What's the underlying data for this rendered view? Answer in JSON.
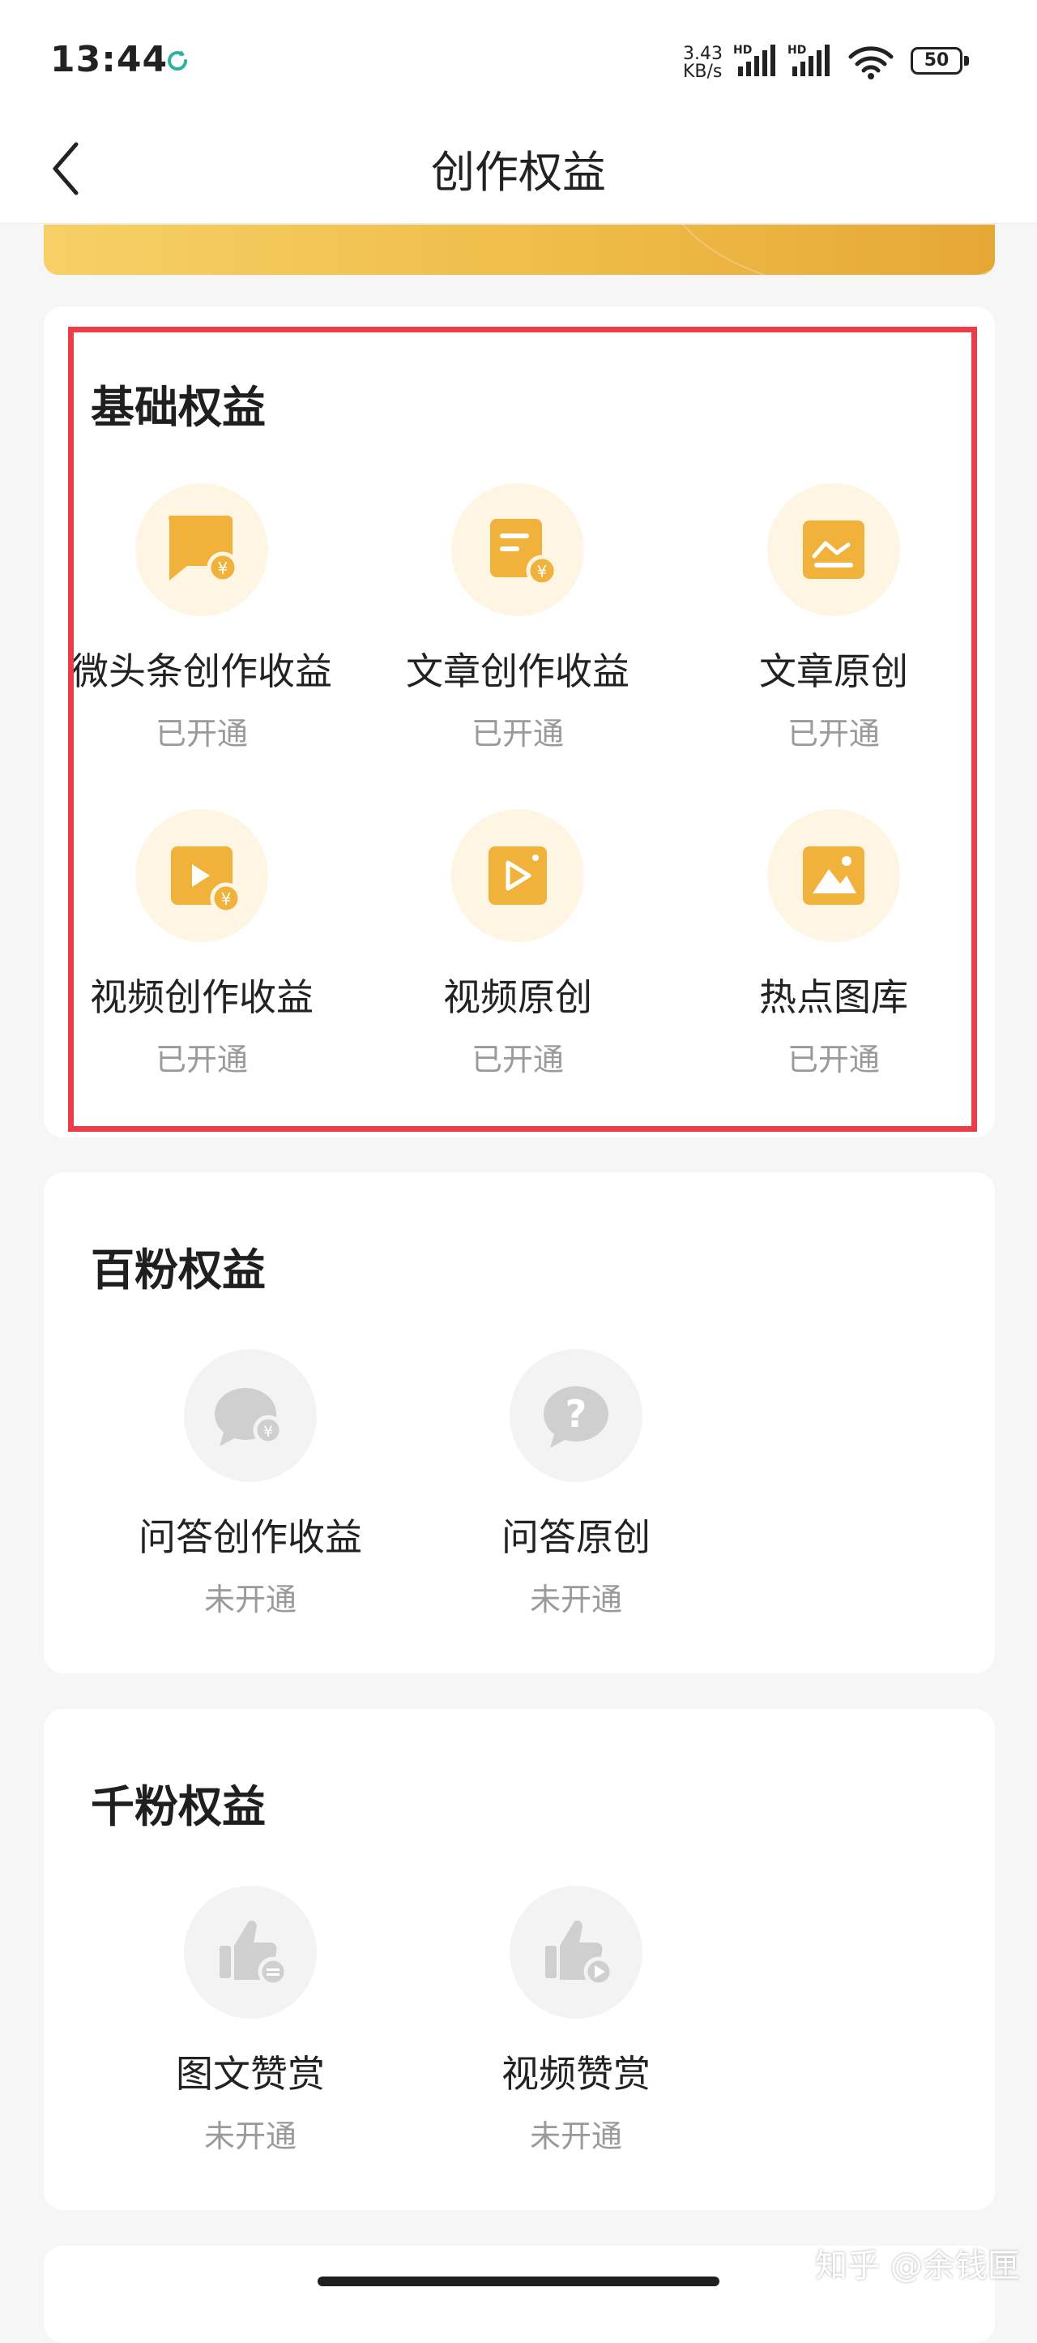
{
  "status_bar": {
    "time": "13:44",
    "speed_value": "3.43",
    "speed_unit": "KB/s",
    "network_1": "HD",
    "network_2": "HD",
    "battery": "50"
  },
  "nav": {
    "title": "创作权益"
  },
  "colors": {
    "accent_gold": "#efbc48",
    "highlight_red": "#ec3b49",
    "status_gray": "#9a9a9a"
  },
  "sections": [
    {
      "title": "基础权益",
      "items": [
        {
          "label": "微头条创作收益",
          "status": "已开通",
          "icon": "speech-bubble-coin-icon"
        },
        {
          "label": "文章创作收益",
          "status": "已开通",
          "icon": "document-coin-icon"
        },
        {
          "label": "文章原创",
          "status": "已开通",
          "icon": "article-chart-icon"
        },
        {
          "label": "视频创作收益",
          "status": "已开通",
          "icon": "video-coin-icon"
        },
        {
          "label": "视频原创",
          "status": "已开通",
          "icon": "video-play-icon"
        },
        {
          "label": "热点图库",
          "status": "已开通",
          "icon": "image-gallery-icon"
        }
      ]
    },
    {
      "title": "百粉权益",
      "items": [
        {
          "label": "问答创作收益",
          "status": "未开通",
          "icon": "qa-coin-icon"
        },
        {
          "label": "问答原创",
          "status": "未开通",
          "icon": "question-bubble-icon"
        }
      ]
    },
    {
      "title": "千粉权益",
      "items": [
        {
          "label": "图文赞赏",
          "status": "未开通",
          "icon": "thumbs-up-text-icon"
        },
        {
          "label": "视频赞赏",
          "status": "未开通",
          "icon": "thumbs-up-video-icon"
        }
      ]
    }
  ],
  "watermark": "知乎 @余钱匣"
}
